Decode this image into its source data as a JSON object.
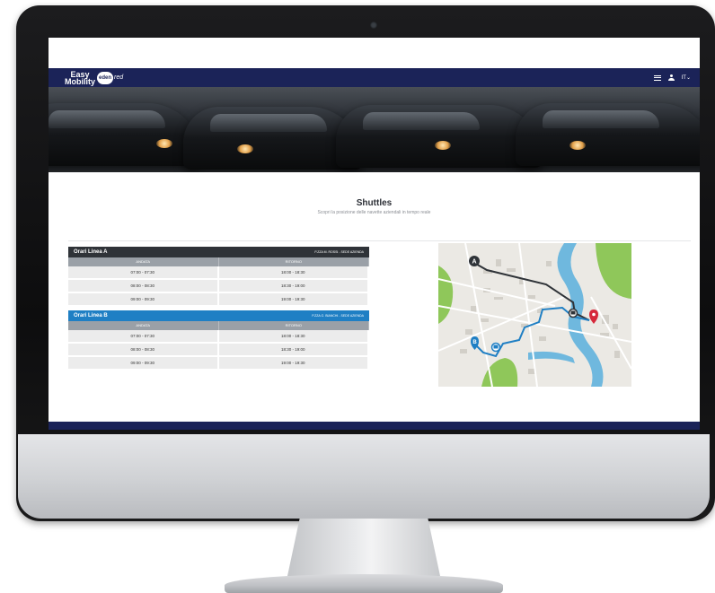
{
  "app": {
    "logo_line1": "Easy",
    "logo_line2": "Mobility",
    "logo_badge": "eden",
    "logo_suffix": "red"
  },
  "navbar": {
    "menu_icon": "menu-icon",
    "user_icon": "user-icon",
    "language_label": "IT",
    "language_caret": "⌄"
  },
  "page": {
    "title": "Shuttles",
    "subtitle": "Scopri la posizione delle navette aziendali in tempo reale"
  },
  "lines": [
    {
      "title": "Orari Linea A",
      "route": "P.ZZA M. ROSSI - SEDE AZIENDA",
      "columns": [
        "ANDATA",
        "RITORNO"
      ],
      "rows": [
        [
          "07:00 - 07:30",
          "18:00 - 18:30"
        ],
        [
          "08:00 - 08:30",
          "18:30 - 19:00"
        ],
        [
          "09:00 - 09:30",
          "19:00 - 19:30"
        ]
      ]
    },
    {
      "title": "Orari Linea B",
      "route": "P.ZZA G. BIANCHI - SEDE AZIENDA",
      "columns": [
        "ANDATA",
        "RITORNO"
      ],
      "rows": [
        [
          "07:00 - 07:30",
          "18:00 - 18:30"
        ],
        [
          "08:00 - 08:30",
          "18:30 - 19:00"
        ],
        [
          "09:00 - 09:30",
          "19:00 - 19:30"
        ]
      ]
    }
  ],
  "map": {
    "marker_a": "A",
    "marker_b": "B",
    "colors": {
      "route_a": "#2f3338",
      "route_b": "#1f7fc4",
      "destination": "#d6283b",
      "water": "#6fb8de",
      "park": "#8fc75a"
    }
  },
  "colors": {
    "navbar": "#1b2358",
    "line_a_header": "#2f3338",
    "line_b_header": "#1f7fc4"
  }
}
